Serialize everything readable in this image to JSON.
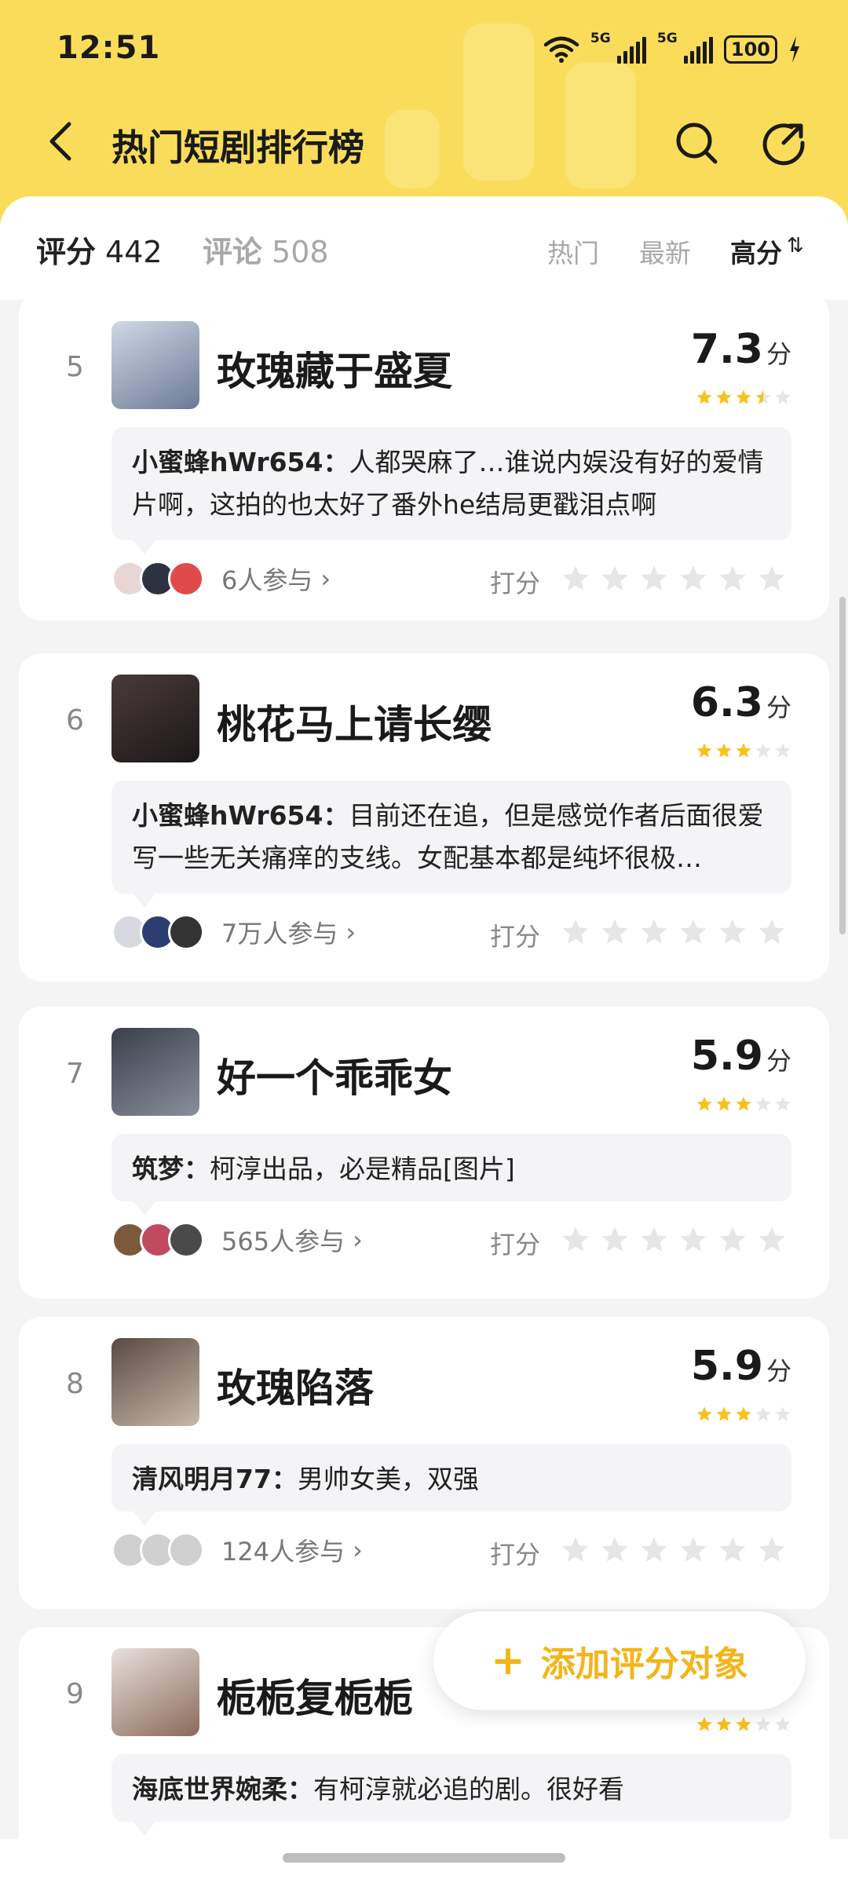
{
  "status_bar": {
    "time": "12:51",
    "signal_1": "5G",
    "signal_2": "5G",
    "battery": "100"
  },
  "nav": {
    "title": "热门短剧排行榜"
  },
  "tabs": {
    "score": {
      "label": "评分",
      "count": "442"
    },
    "review": {
      "label": "评论",
      "count": "508"
    }
  },
  "sort": {
    "hot": "热门",
    "new": "最新",
    "high": "高分",
    "high_arrows": "⇅"
  },
  "items": [
    {
      "rank": "5",
      "title": "玫瑰藏于盛夏",
      "score": "7.3",
      "unit": "分",
      "stars_filled": 3.5,
      "comment_author": "小蜜蜂hWr654：",
      "comment_text": "人都哭麻了…谁说内娱没有好的爱情片啊，这拍的也太好了番外he结局更戳泪点啊",
      "participants": "6人参与",
      "rate_label": "打分",
      "poster_colors": [
        "#cfd8e6",
        "#6b7a94"
      ],
      "avatar_colors": [
        "#e8d6d6",
        "#2d3240",
        "#e24a4a"
      ]
    },
    {
      "rank": "6",
      "title": "桃花马上请长缨",
      "score": "6.3",
      "unit": "分",
      "stars_filled": 3,
      "comment_author": "小蜜蜂hWr654：",
      "comment_text": "目前还在追，但是感觉作者后面很爱写一些无关痛痒的支线。女配基本都是纯坏很极…",
      "participants": "7万人参与",
      "rate_label": "打分",
      "poster_colors": [
        "#4a3a3a",
        "#1c1818"
      ],
      "avatar_colors": [
        "#d8d8e0",
        "#2c3e70",
        "#333333"
      ]
    },
    {
      "rank": "7",
      "title": "好一个乖乖女",
      "score": "5.9",
      "unit": "分",
      "stars_filled": 3,
      "comment_author": "筑梦：",
      "comment_text": "柯淳出品，必是精品[图片]",
      "participants": "565人参与",
      "rate_label": "打分",
      "poster_colors": [
        "#3a3f4a",
        "#8a8f9c"
      ],
      "avatar_colors": [
        "#7a5a3a",
        "#c04a60",
        "#4a4a4a"
      ]
    },
    {
      "rank": "8",
      "title": "玫瑰陷落",
      "score": "5.9",
      "unit": "分",
      "stars_filled": 3,
      "comment_author": "清风明月77：",
      "comment_text": "男帅女美，双强",
      "participants": "124人参与",
      "rate_label": "打分",
      "poster_colors": [
        "#5a4a44",
        "#c8b8a8"
      ],
      "avatar_colors": [
        "#d0d0d0",
        "#d0d0d0",
        "#d0d0d0"
      ]
    },
    {
      "rank": "9",
      "title": "栀栀复栀栀",
      "score": "",
      "unit": "",
      "stars_filled": 3,
      "comment_author": "海底世界婉柔：",
      "comment_text": "有柯淳就必追的剧。很好看",
      "participants": "",
      "rate_label": "",
      "poster_colors": [
        "#e8e0dc",
        "#8a6a5a"
      ],
      "avatar_colors": [
        "#d0d0d0",
        "#d0d0d0",
        "#d0d0d0"
      ]
    }
  ],
  "fab": {
    "plus": "+",
    "label": "添加评分对象"
  },
  "colors": {
    "header_yellow": "#f9dd5a",
    "star_yellow": "#f6c21c",
    "star_gray": "#e6e6e6",
    "accent": "#f2b51b"
  },
  "icons": [
    "back-arrow-icon",
    "search-icon",
    "share-icon",
    "wifi-icon",
    "star-icon",
    "chevron-right-icon"
  ]
}
